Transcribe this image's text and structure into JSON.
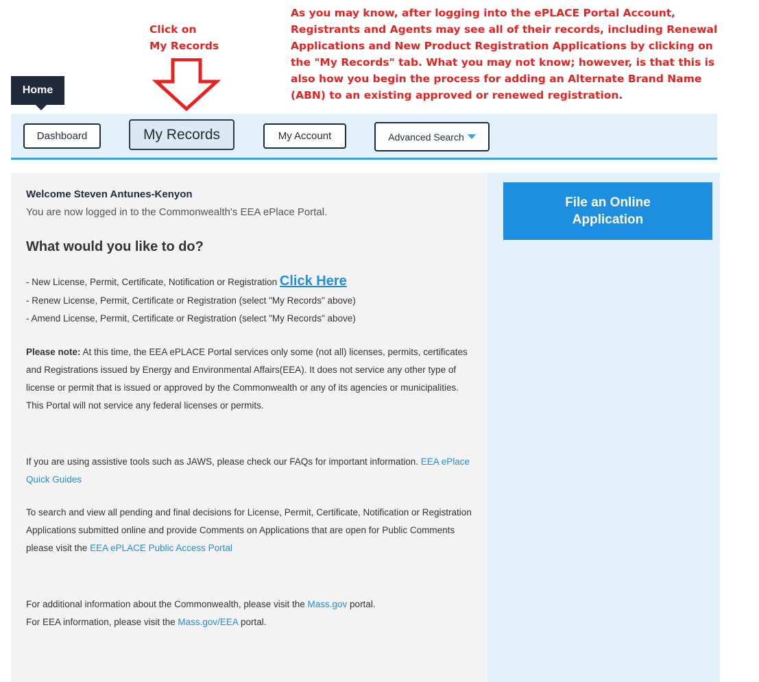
{
  "annotation": {
    "click_line1": "Click on",
    "click_line2": "My Records",
    "note_lines": [
      "As you may know, after logging into the ePLACE Portal Account,",
      "Registrants and Agents may see all of their records, including Renewal",
      "Applications and New Product Registration Applications by clicking on",
      "the \"My Records\" tab.  What you may not know; however, is that this is",
      "also how you begin the process for adding an Alternate Brand Name",
      "(ABN) to an existing approved or renewed registration."
    ],
    "color": "#e8231f"
  },
  "home_tab": "Home",
  "nav": {
    "dashboard": "Dashboard",
    "my_records": "My Records",
    "my_account": "My Account",
    "advanced_search": "Advanced Search"
  },
  "main": {
    "welcome": "Welcome Steven Antunes-Kenyon",
    "logged_in": "You are now logged in to the Commonwealth's EEA ePlace Portal.",
    "question": "What would you like to do?",
    "option1": "- New License, Permit, Certificate, Notification or Registration",
    "option1_link": "Click Here",
    "option2": "- Renew License, Permit, Certificate or Registration (select \"My Records\" above)",
    "option3": "- Amend License, Permit, Certificate or Registration (select \"My Records\" above)",
    "note_label": "Please note:",
    "note_text": "At this time, the EEA ePLACE Portal services only some (not all) licenses, permits, certificates and Registrations issued by Energy and Environmental Affairs(EEA). It does not service any other type of license or permit that is issued or approved by the Commonwealth or any of its agencies or municipalities. This Portal will not service any federal licenses or permits.",
    "assistive_text": "If you are using assistive tools such as JAWS, please check our FAQs for important information.",
    "assistive_link": "EEA ePlace Quick Guides",
    "search_text": "To search and view all pending and final decisions for License, Permit, Certificate, Notification or Registration Applications submitted online and provide Comments on Applications that are open for Public Comments please visit the",
    "search_link": "EEA ePLACE Public Access Portal",
    "info_text1": "For additional information about the Commonwealth, please visit the",
    "info_link1": "Mass.gov",
    "info_text1b": "portal.",
    "info_text2": "For EEA information, please visit the",
    "info_link2": "Mass.gov/EEA",
    "info_text2b": "portal."
  },
  "sidebar": {
    "file_button": "File an Online Application"
  },
  "colors": {
    "accent": "#1e8fe0",
    "nav_bg": "#e3f1fa",
    "dark": "#1f2a3a"
  }
}
